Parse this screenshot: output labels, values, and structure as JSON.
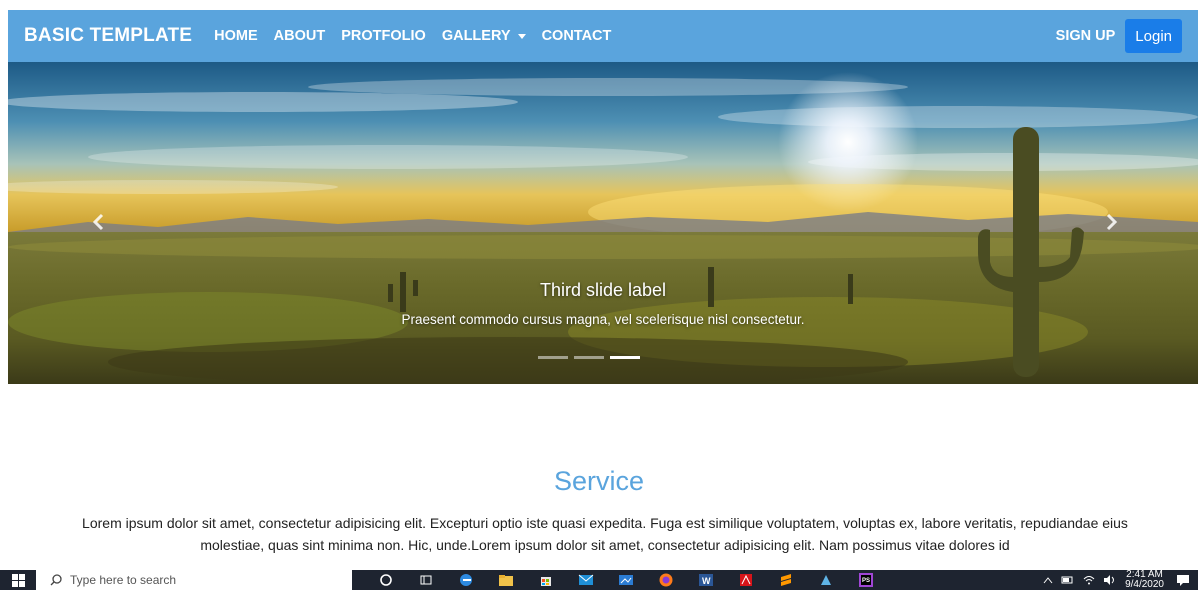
{
  "nav": {
    "brand": "BASIC TEMPLATE",
    "links": [
      "HOME",
      "ABOUT",
      "PROTFOLIO",
      "GALLERY",
      "CONTACT"
    ],
    "signup": "SIGN UP",
    "login": "Login"
  },
  "carousel": {
    "caption_title": "Third slide label",
    "caption_text": "Praesent commodo cursus magna, vel scelerisque nisl consectetur.",
    "slide_count": 3,
    "active_slide": 3
  },
  "service": {
    "title": "Service",
    "text": "Lorem ipsum dolor sit amet, consectetur adipisicing elit. Excepturi optio iste quasi expedita. Fuga est similique voluptatem, voluptas ex, labore veritatis, repudiandae eius molestiae, quas sint minima non. Hic, unde.Lorem ipsum dolor sit amet, consectetur adipisicing elit. Nam possimus vitae dolores id"
  },
  "taskbar": {
    "search_placeholder": "Type here to search",
    "time": "2:41 AM",
    "date": "9/4/2020"
  },
  "colors": {
    "navbar": "#5aa4dd",
    "login_button": "#1a7de8",
    "service_title": "#5aa4dd",
    "taskbar": "#1e2430"
  }
}
